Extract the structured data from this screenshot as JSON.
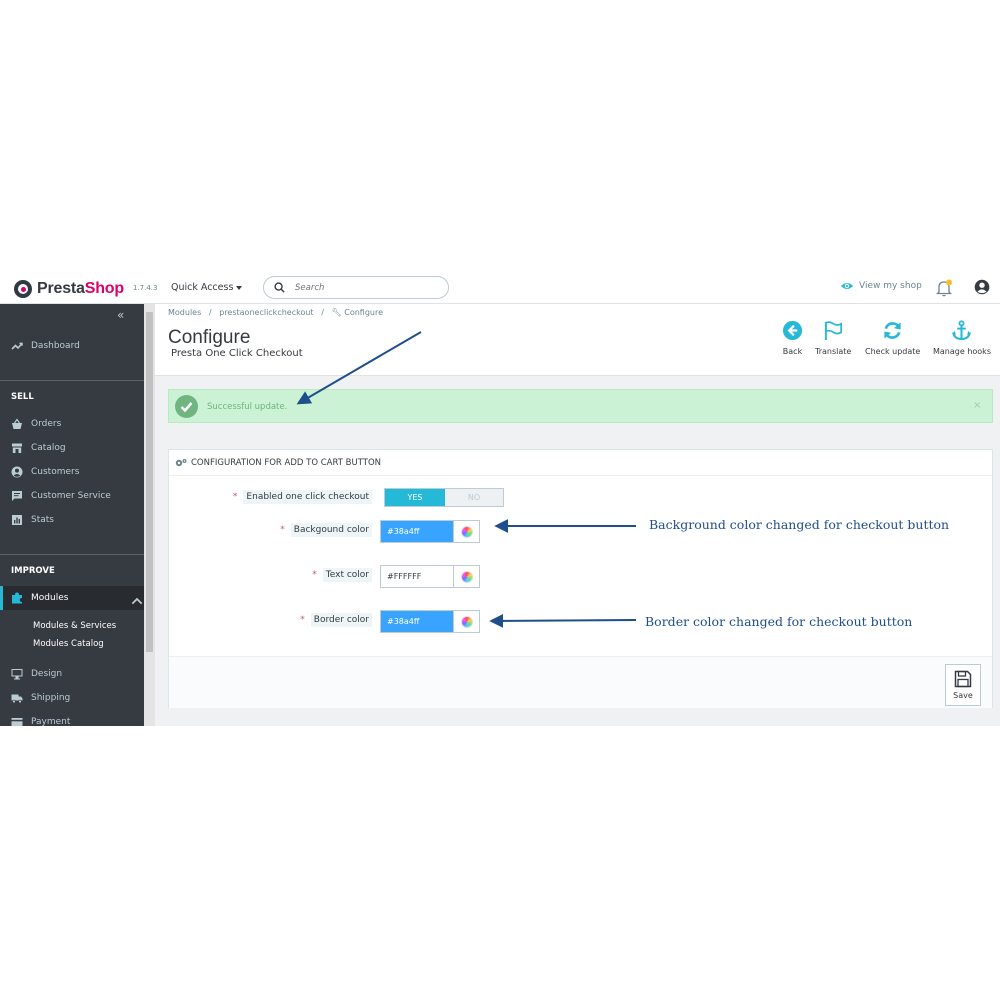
{
  "header": {
    "logo_prefix": "Presta",
    "logo_suffix": "Shop",
    "version": "1.7.4.3",
    "quick_access": "Quick Access",
    "search_placeholder": "Search",
    "view_my_shop": "View my shop"
  },
  "sidebar": {
    "dashboard": "Dashboard",
    "sell_title": "SELL",
    "sell_items": [
      "Orders",
      "Catalog",
      "Customers",
      "Customer Service",
      "Stats"
    ],
    "improve_title": "IMPROVE",
    "modules": "Modules",
    "module_sub": [
      "Modules & Services",
      "Modules Catalog"
    ],
    "more_items": [
      "Design",
      "Shipping",
      "Payment"
    ]
  },
  "breadcrumb": [
    "Modules",
    "prestaoneclickcheckout",
    "Configure"
  ],
  "page": {
    "title": "Configure",
    "subtitle": "Presta One Click Checkout"
  },
  "toolbar": [
    "Back",
    "Translate",
    "Check update",
    "Manage hooks"
  ],
  "alert": {
    "message": "Successful update.",
    "close": "×"
  },
  "panel": {
    "title": "CONFIGURATION FOR ADD TO CART BUTTON",
    "enable_label": "Enabled one click checkout",
    "switch_on": "YES",
    "switch_off": "NO",
    "switch_value": "YES",
    "fields": [
      {
        "label": "Backgound color",
        "value": "#38a4ff",
        "swatch": "#38a4ff"
      },
      {
        "label": "Text color",
        "value": "#FFFFFF",
        "swatch": "#ffffff"
      },
      {
        "label": "Border color",
        "value": "#38a4ff",
        "swatch": "#38a4ff"
      }
    ],
    "save": "Save"
  },
  "annotations": {
    "background_note": "Background color changed for checkout button",
    "border_note": "Border color changed for checkout button"
  },
  "colors": {
    "accent": "#25b9d7",
    "sidebar_bg": "#363a41",
    "success": "#70b580",
    "annotation": "#1f4e8c",
    "brand_pink": "#df0067"
  }
}
